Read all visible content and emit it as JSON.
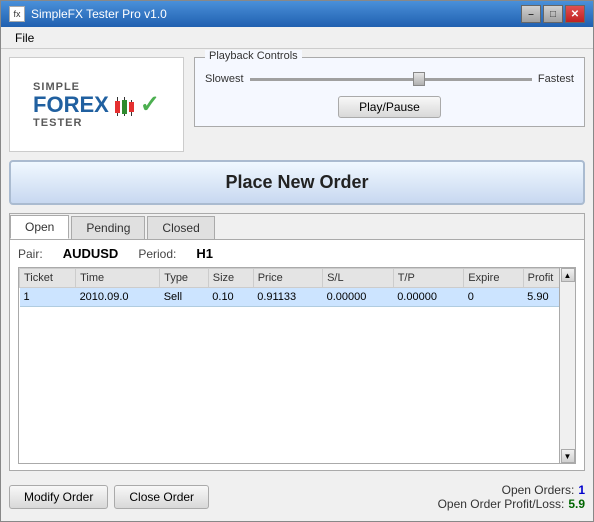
{
  "window": {
    "title": "SimpleFX Tester Pro v1.0",
    "minimize_label": "–",
    "maximize_label": "□",
    "close_label": "✕"
  },
  "menu": {
    "file_label": "File"
  },
  "logo": {
    "simple": "SIMPLE",
    "forex": "FOREX",
    "tester": "TESTER"
  },
  "playback": {
    "legend": "Playback Controls",
    "slowest_label": "Slowest",
    "fastest_label": "Fastest",
    "play_pause_label": "Play/Pause"
  },
  "place_order": {
    "label": "Place New Order"
  },
  "tabs": {
    "open_label": "Open",
    "pending_label": "Pending",
    "closed_label": "Closed",
    "active": "open"
  },
  "pair": {
    "label": "Pair:",
    "value": "AUDUSD",
    "period_label": "Period:",
    "period_value": "H1"
  },
  "table": {
    "headers": [
      "Ticket",
      "Time",
      "Type",
      "Size",
      "Price",
      "S/L",
      "T/P",
      "Expire",
      "Profit"
    ],
    "rows": [
      {
        "ticket": "1",
        "time": "2010.09.0",
        "type": "Sell",
        "size": "0.10",
        "price": "0.91133",
        "sl": "0.00000",
        "tp": "0.00000",
        "expire": "0",
        "profit": "5.90"
      }
    ]
  },
  "buttons": {
    "modify_order": "Modify Order",
    "close_order": "Close Order"
  },
  "stats": {
    "open_orders_label": "Open Orders:",
    "open_orders_value": "1",
    "profit_loss_label": "Open Order Profit/Loss:",
    "profit_loss_value": "5.9"
  }
}
